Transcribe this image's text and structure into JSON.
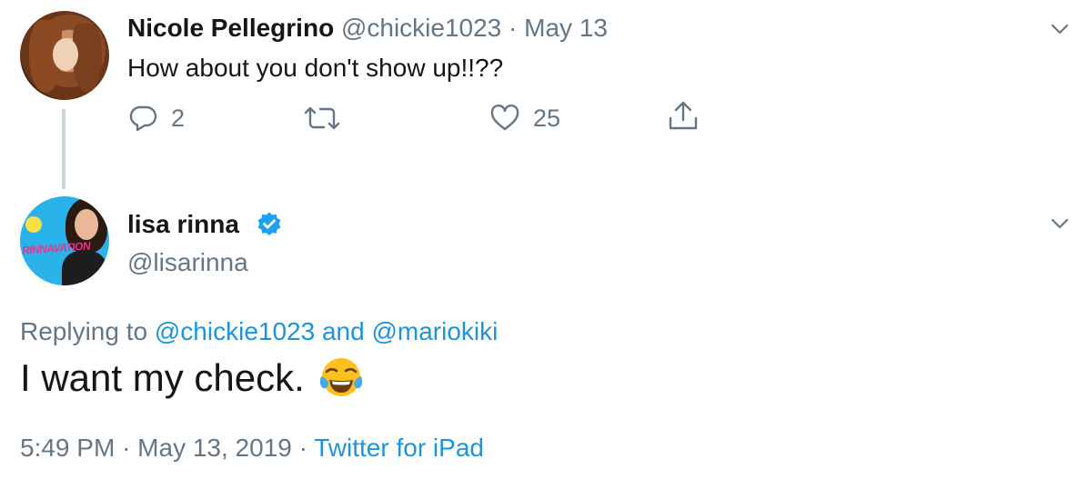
{
  "parent_tweet": {
    "author_name": "Nicole Pellegrino",
    "author_handle": "@chickie1023",
    "separator": "·",
    "date": "May 13",
    "text": "How about you don't show up!!??",
    "reply_count": "2",
    "retweet_count": "",
    "like_count": "25",
    "icons": [
      "reply-icon",
      "retweet-icon",
      "like-icon",
      "share-icon",
      "chevron-down-icon"
    ]
  },
  "main_tweet": {
    "author_name": "lisa rinna",
    "author_handle": "@lisarinna",
    "verified": true,
    "avatar_text": "RINNAVATION",
    "replying_prefix": "Replying to",
    "replying_to": [
      "@chickie1023",
      "@mariokiki"
    ],
    "replying_and": "and",
    "text": "I want my check.",
    "emoji": "face-with-tears-of-joy",
    "time": "5:49 PM",
    "separator": "·",
    "date": "May 13, 2019",
    "source": "Twitter for iPad"
  },
  "colors": {
    "text_primary": "#14171a",
    "text_secondary": "#657786",
    "link": "#1b95e0",
    "verified": "#1da1f2",
    "thread_line": "#ccd6dd"
  }
}
